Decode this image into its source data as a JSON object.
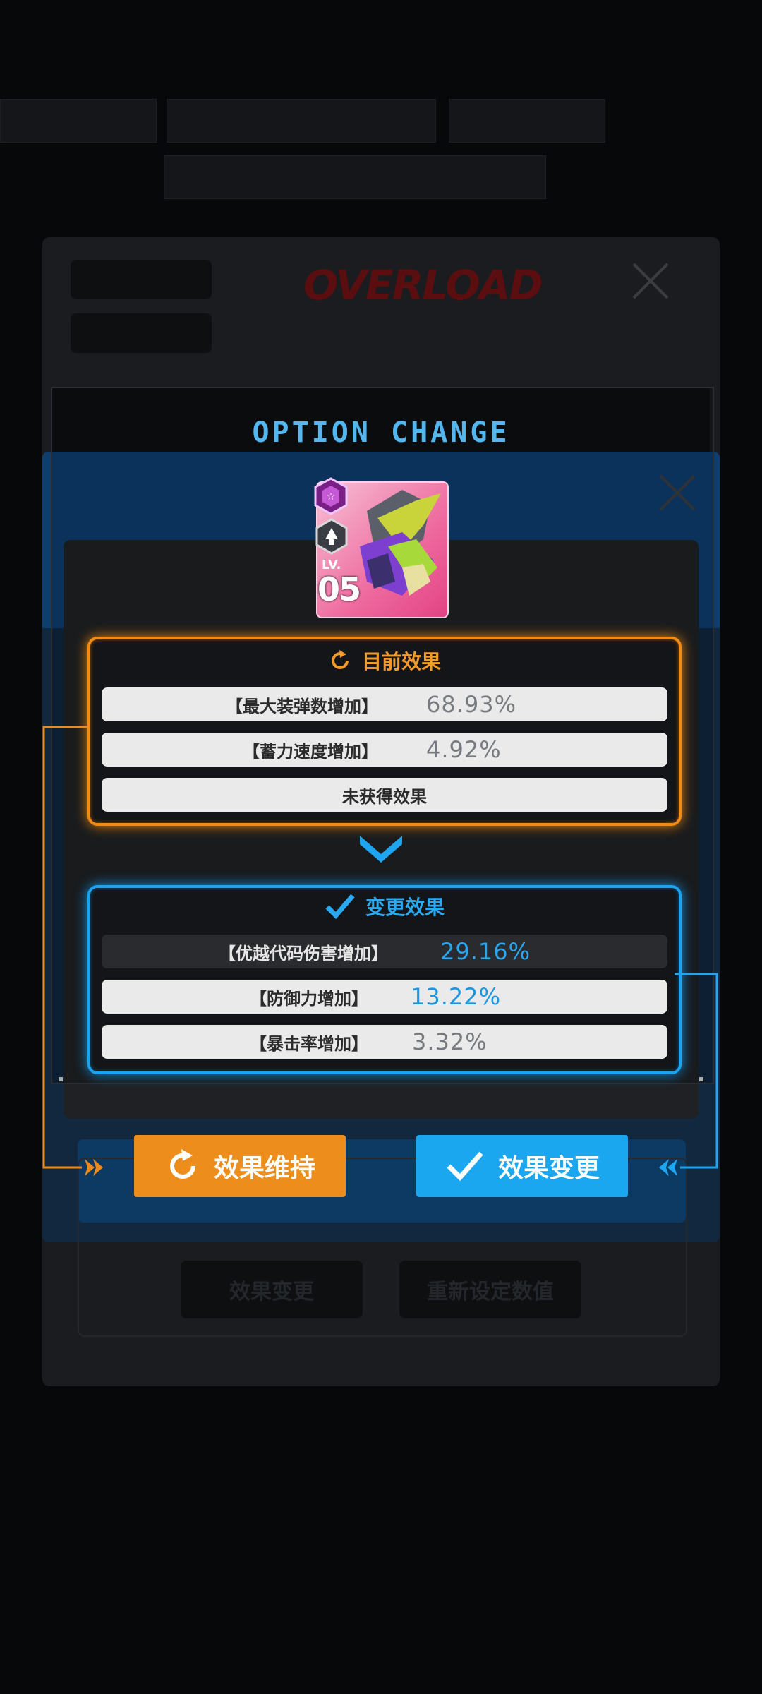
{
  "modal": {
    "title": "OPTION CHANGE"
  },
  "item": {
    "level_label": "LV.",
    "level_value": "05"
  },
  "current_effects": {
    "heading": "目前效果",
    "rows": [
      {
        "label": "【最大装弹数增加】",
        "value": "68.93%"
      },
      {
        "label": "【蓄力速度增加】",
        "value": "4.92%"
      },
      {
        "label": "未获得效果",
        "value": ""
      }
    ]
  },
  "changed_effects": {
    "heading": "变更效果",
    "rows": [
      {
        "label": "【优越代码伤害增加】",
        "value": "29.16%"
      },
      {
        "label": "【防御力增加】",
        "value": "13.22%"
      },
      {
        "label": "【暴击率增加】",
        "value": "3.32%"
      }
    ]
  },
  "buttons": {
    "keep_label": "效果维持",
    "change_label": "效果变更"
  },
  "background": {
    "logo_text": "OVERLOAD",
    "faded_button_left": "效果变更",
    "faded_button_right": "重新设定数值"
  },
  "colors": {
    "accent_orange": "#ed8e1c",
    "accent_blue": "#1ba7f0",
    "title_blue": "#54b6ef",
    "card_pink": "#ee6b9f"
  },
  "icons": {
    "current_heading": "refresh-icon",
    "changed_heading": "check-icon",
    "separator": "chevron-down-icon",
    "keep_button": "refresh-icon",
    "change_button": "check-icon",
    "left_pointer": "double-chevron-right-icon",
    "right_pointer": "double-chevron-left-icon"
  }
}
